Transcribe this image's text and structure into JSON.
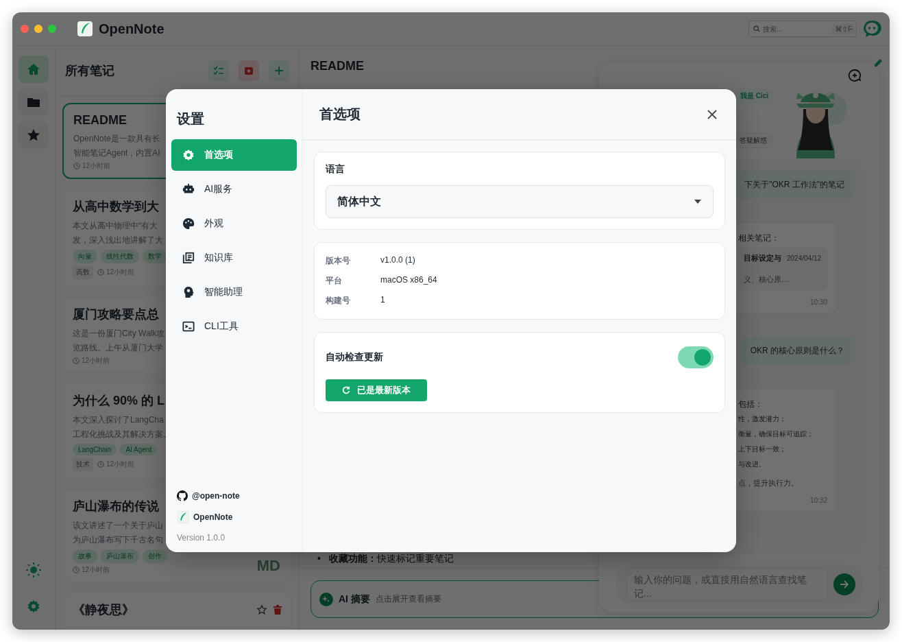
{
  "window": {
    "app_name": "OpenNote",
    "search": {
      "placeholder": "搜索...",
      "shortcut": "⌘⇧F"
    }
  },
  "rail": {
    "items": [
      {
        "selected": true
      },
      {
        "selected": false
      },
      {
        "selected": false
      }
    ]
  },
  "note_list": {
    "title": "所有笔记",
    "notes": [
      {
        "title": "README",
        "selected": true,
        "summary": [
          "OpenNote是一款具有长",
          "智能笔记Agent，内置AI"
        ],
        "time": "12小时前"
      },
      {
        "title": "从高中数学到大",
        "selected": false,
        "summary": [
          "本文从高中物理中“有大",
          "发，深入浅出地讲解了大"
        ],
        "tags": [
          "向量",
          "线性代数",
          "数学"
        ],
        "category": "高数",
        "time": "12小时前"
      },
      {
        "title": "厦门攻略要点总",
        "selected": false,
        "summary": [
          "这是一份厦门City Walk攻",
          "览路线。上午从厦门大学"
        ],
        "time": "12小时前"
      },
      {
        "title": "为什么 90% 的 L",
        "selected": false,
        "summary": [
          "本文深入探讨了LangCha",
          "工程化挑战及其解决方案。"
        ],
        "tags": [
          "LangChain",
          "AI Agent"
        ],
        "category": "技术",
        "time": "12小时前"
      },
      {
        "title": "庐山瀑布的传说",
        "selected": false,
        "summary": [
          "该文讲述了一个关于庐山",
          "为庐山瀑布写下千古名句"
        ],
        "tags": [
          "故事",
          "庐山瀑布",
          "创作"
        ],
        "time": "12小时前",
        "badge": "MD"
      },
      {
        "title": "《静夜思》",
        "selected": false
      }
    ]
  },
  "editor": {
    "title": "README",
    "bullet_marker": "•",
    "bullet": "**收藏功能：**快速标记重要笔记",
    "ai_summary": {
      "label": "AI 摘要",
      "hint": "点击展开查看摘要"
    }
  },
  "chat": {
    "greeting_badge": "我是 Cici",
    "chip": "答疑解惑",
    "messages": [
      {
        "kind": "user",
        "text": "下关于\"OKR 工作法\"的笔记"
      },
      {
        "kind": "assistant",
        "lines": [
          "相关笔记："
        ],
        "note": {
          "title": "目标设定与",
          "date": "2024/04/12",
          "excerpt": "义、核心原…"
        },
        "time": "10:30"
      },
      {
        "kind": "user",
        "text": "OKR 的核心原则是什么？"
      },
      {
        "kind": "assistant",
        "lines": [
          "包括：",
          "性，激发潜力；",
          "衡量，确保目标可追踪；",
          "上下目标一致；",
          "与改进。"
        ],
        "footnote": "点，提升执行力。",
        "time": "10:32"
      }
    ],
    "input_placeholder": "输入你的问题，或直接用自然语言查找笔记..."
  },
  "settings": {
    "title": "设置",
    "nav": [
      {
        "label": "首选项",
        "selected": true
      },
      {
        "label": "AI服务",
        "selected": false
      },
      {
        "label": "外观",
        "selected": false
      },
      {
        "label": "知识库",
        "selected": false
      },
      {
        "label": "智能助理",
        "selected": false
      },
      {
        "label": "CLI工具",
        "selected": false
      }
    ],
    "footer": {
      "github": "@open-note",
      "app": "OpenNote",
      "version": "Version 1.0.0"
    },
    "page_title": "首选项",
    "language": {
      "label": "语言",
      "value": "简体中文"
    },
    "info": [
      {
        "key": "版本号",
        "value": "v1.0.0 (1)"
      },
      {
        "key": "平台",
        "value": "macOS x86_64"
      },
      {
        "key": "构建号",
        "value": "1"
      }
    ],
    "auto_update": {
      "label": "自动检查更新",
      "on": true,
      "button": "已是最新版本"
    }
  }
}
